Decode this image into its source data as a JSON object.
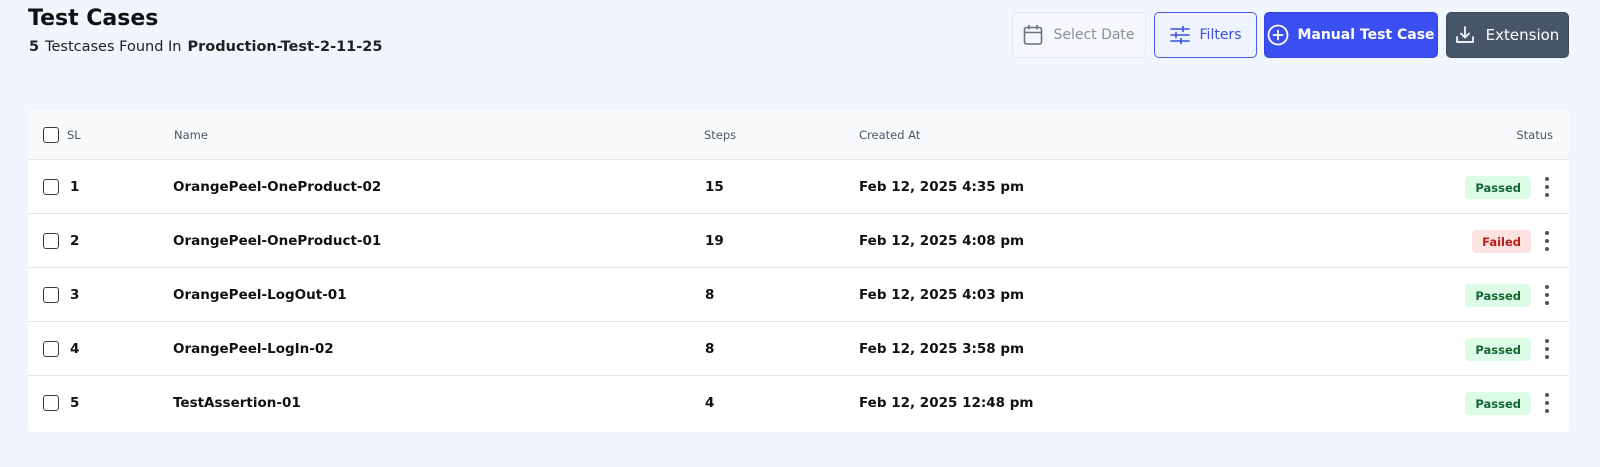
{
  "header": {
    "title": "Test Cases",
    "count": "5",
    "found_text": "Testcases Found In",
    "suite_name": "Production-Test-2-11-25"
  },
  "toolbar": {
    "select_date_label": "Select Date",
    "filters_label": "Filters",
    "manual_label": "Manual Test Case",
    "extension_label": "Extension"
  },
  "table": {
    "headers": {
      "sl": "SL",
      "name": "Name",
      "steps": "Steps",
      "created_at": "Created At",
      "status": "Status"
    },
    "rows": [
      {
        "sl": "1",
        "name": "OrangePeel-OneProduct-02",
        "steps": "15",
        "created_at": "Feb 12, 2025 4:35 pm",
        "status": "Passed"
      },
      {
        "sl": "2",
        "name": "OrangePeel-OneProduct-01",
        "steps": "19",
        "created_at": "Feb 12, 2025 4:08 pm",
        "status": "Failed"
      },
      {
        "sl": "3",
        "name": "OrangePeel-LogOut-01",
        "steps": "8",
        "created_at": "Feb 12, 2025 4:03 pm",
        "status": "Passed"
      },
      {
        "sl": "4",
        "name": "OrangePeel-LogIn-02",
        "steps": "8",
        "created_at": "Feb 12, 2025 3:58 pm",
        "status": "Passed"
      },
      {
        "sl": "5",
        "name": "TestAssertion-01",
        "steps": "4",
        "created_at": "Feb 12, 2025 12:48 pm",
        "status": "Passed"
      }
    ]
  },
  "colors": {
    "primary": "#3b4ff0",
    "dark_button": "#475569",
    "passed_bg": "#dcfce7",
    "passed_text": "#166534",
    "failed_bg": "#fde2e2",
    "failed_text": "#b91c1c",
    "page_bg": "#f1f6fe"
  }
}
